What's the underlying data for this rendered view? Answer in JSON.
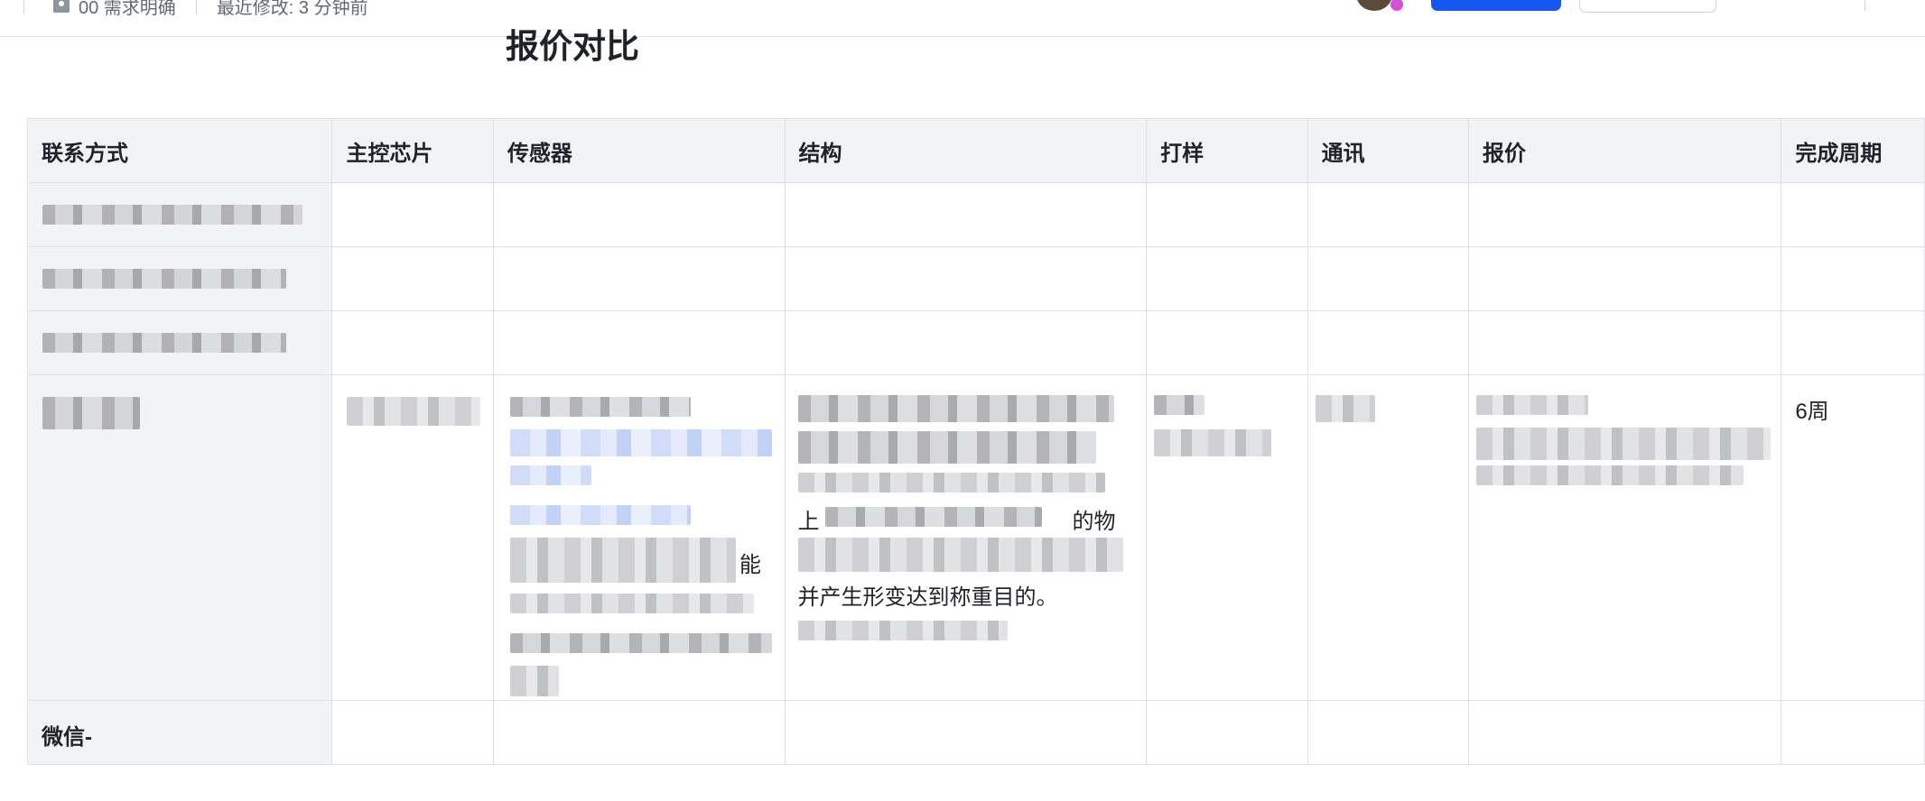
{
  "topbar": {
    "status_label": "00 需求明确",
    "modified_label": "最近修改: 3 分钟前"
  },
  "doc": {
    "title": "报价对比"
  },
  "table": {
    "headers": [
      "联系方式",
      "主控芯片",
      "传感器",
      "结构",
      "打样",
      "通讯",
      "报价",
      "完成周期"
    ],
    "cells": {
      "cycle_row4": "6周",
      "contact_row5": "微信-",
      "structure_fragment_1": "上",
      "structure_fragment_2": "的物",
      "structure_fragment_3": "并产生形变达到称重目的。",
      "sensor_fragment": "能"
    }
  }
}
